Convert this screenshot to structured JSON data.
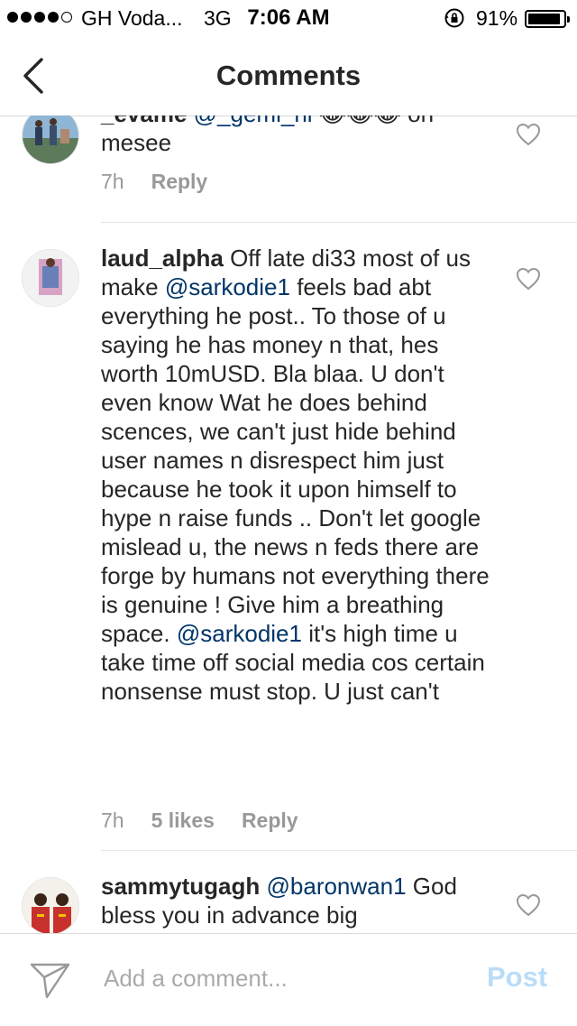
{
  "status_bar": {
    "carrier": "GH Voda...",
    "network": "3G",
    "time": "7:06 AM",
    "battery": "91%",
    "battery_level": 0.91
  },
  "nav": {
    "title": "Comments",
    "back_icon": "chevron-left-icon"
  },
  "comments": [
    {
      "username": "_evame",
      "mention": "@_gemi_ni",
      "emojis": "😂😂😂",
      "text": "oh mesee",
      "time": "7h",
      "reply": "Reply"
    },
    {
      "username": "laud_alpha",
      "text_a": "Off late di33 most of us make",
      "mention_a": "@sarkodie1",
      "text_b": "feels bad abt everything  he post.. To those of u saying  he has money n that, hes worth 10mUSD. Bla blaa.  U don't even know Wat he does behind scences,  we can't just hide behind  user names n disrespect him just because  he took it upon himself  to hype n raise funds .. Don't let google mislead u, the news n feds there are forge by humans  not everything  there is genuine ! Give him a breathing space.",
      "mention_b": "@sarkodie1",
      "text_c": "it's high time u take time off social media cos certain nonsense must stop.  U just can't",
      "time": "7h",
      "likes": "5 likes",
      "reply": "Reply"
    },
    {
      "username": "sammytugagh",
      "mention": "@baronwan1",
      "text": "God bless you in advance big"
    }
  ],
  "composer": {
    "placeholder": "Add a comment...",
    "post_label": "Post",
    "send_icon": "direct-send-icon"
  },
  "colors": {
    "mention": "#003569",
    "muted": "#999999",
    "post_disabled": "#b9dcf8"
  }
}
